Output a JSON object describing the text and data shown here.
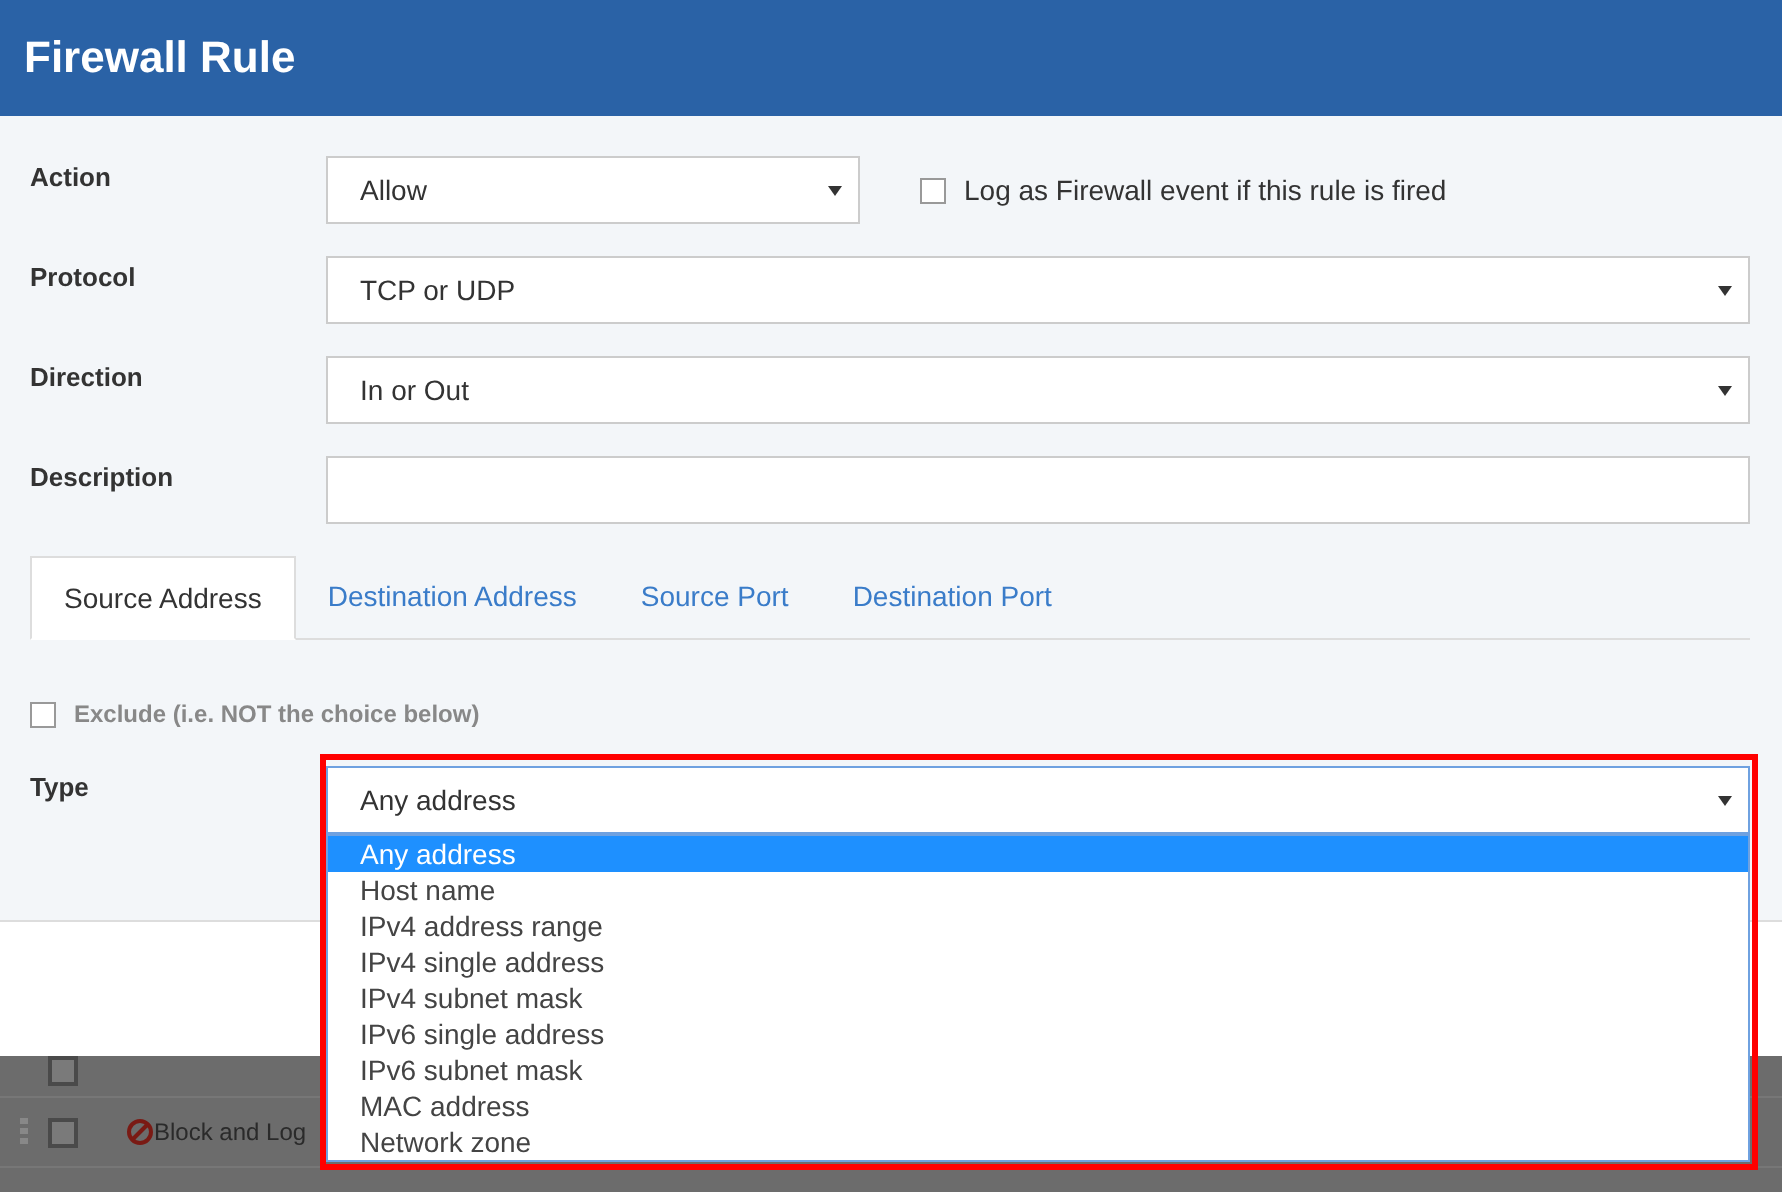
{
  "window": {
    "title": "Firewall Rule"
  },
  "fields": [
    {
      "label": "Action",
      "kind": "select",
      "value": "Allow",
      "checkbox": {
        "label": "Log as Firewall event if this rule is fired",
        "checked": false
      }
    },
    {
      "label": "Protocol",
      "kind": "select",
      "value": "TCP or UDP"
    },
    {
      "label": "Direction",
      "kind": "select",
      "value": "In or Out"
    },
    {
      "label": "Description",
      "kind": "text"
    }
  ],
  "tabs": [
    {
      "label": "Source Address",
      "selected": true
    },
    {
      "label": "Destination Address",
      "selected": false
    },
    {
      "label": "Source Port",
      "selected": false
    },
    {
      "label": "Destination Port",
      "selected": false
    }
  ],
  "exclude": {
    "label": "Exclude (i.e. NOT the choice below)",
    "checked": false
  },
  "type": {
    "label": "Type",
    "value": "Any address",
    "expanded": true,
    "options": [
      {
        "label": "Any address",
        "selected": true
      },
      {
        "label": "Host name",
        "selected": false
      },
      {
        "label": "IPv4 address range",
        "selected": false
      },
      {
        "label": "IPv4 single address",
        "selected": false
      },
      {
        "label": "IPv4 subnet mask",
        "selected": false
      },
      {
        "label": "IPv6 single address",
        "selected": false
      },
      {
        "label": "IPv6 subnet mask",
        "selected": false
      },
      {
        "label": "MAC address",
        "selected": false
      },
      {
        "label": "Network zone",
        "selected": false
      }
    ]
  },
  "background_rows": [
    {
      "kind": "hidden",
      "checked": false
    },
    {
      "kind": "block",
      "text": "Block and Log",
      "checked": false
    }
  ]
}
